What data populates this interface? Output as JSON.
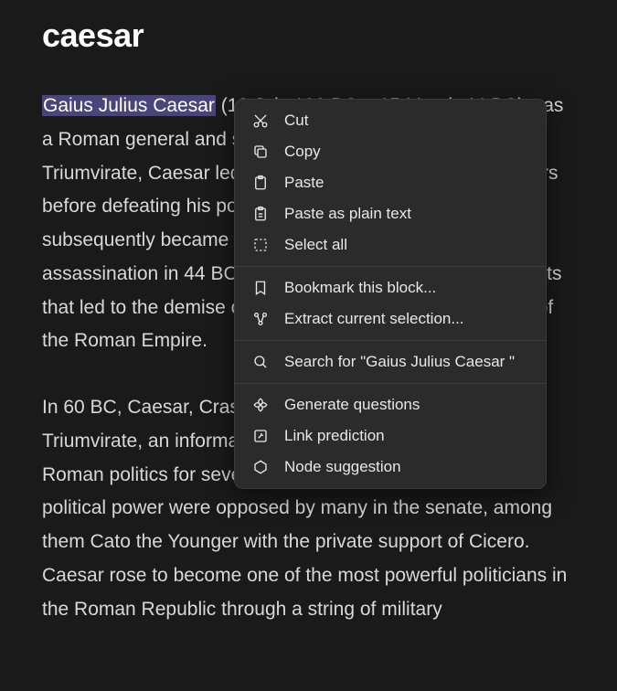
{
  "title": "caesar",
  "selection_text": "Gaius Julius Caesar",
  "paragraph1_tail": " (12 July 100 BC – 15 March 44 BC) was a Roman general and statesman. A member of the First Triumvirate, Caesar led the Roman armies in the Gallic Wars before defeating his political rival Pompey in a civil war, and subsequently became dictator from 49 BC until his assassination in 44 BC. He played a critical role in the events that led to the demise of the Roman Republic and the rise of the Roman Empire.",
  "paragraph2": "In 60 BC, Caesar, Crassus, and Pompey formed the First Triumvirate, an informal political alliance that dominated Roman politics for several years. Their attempts to amass political power were opposed by many in the senate, among them Cato the Younger with the private support of Cicero. Caesar rose to become one of the most powerful politicians in the Roman Republic through a string of military",
  "menu": {
    "cut": "Cut",
    "copy": "Copy",
    "paste": "Paste",
    "paste_plain": "Paste as plain text",
    "select_all": "Select all",
    "bookmark": "Bookmark this block...",
    "extract": "Extract current selection...",
    "search": "Search for \"Gaius Julius Caesar \"",
    "generate": "Generate questions",
    "link_pred": "Link prediction",
    "node_sugg": "Node suggestion"
  }
}
